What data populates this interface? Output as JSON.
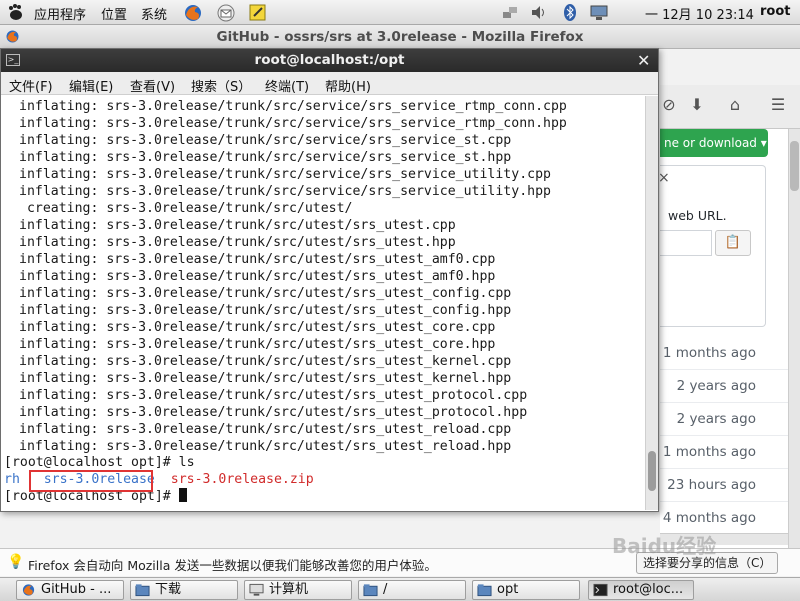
{
  "top_panel": {
    "applications": "应用程序",
    "places": "位置",
    "system": "系统",
    "clock": "一 12月 10 23:14",
    "user": "root"
  },
  "firefox": {
    "title": "GitHub - ossrs/srs at 3.0release - Mozilla Firefox",
    "clone_button": "ne or download ▾",
    "clone_popup_text": "web URL.",
    "commit_times": [
      "1 months ago",
      "2 years ago",
      "2 years ago",
      "1 months ago",
      "23 hours ago",
      "4 months ago"
    ],
    "notification": "Firefox 会自动向 Mozilla 发送一些数据以便我们能够改善您的用户体验。",
    "notification_button": "选择要分享的信息（C）"
  },
  "terminal": {
    "title": "root@localhost:/opt",
    "menu": [
      "文件(F)",
      "编辑(E)",
      "查看(V)",
      "搜索（S）",
      "终端(T)",
      "帮助(H)"
    ],
    "lines": [
      "inflating: srs-3.0release/trunk/src/service/srs_service_rtmp_conn.cpp",
      "inflating: srs-3.0release/trunk/src/service/srs_service_rtmp_conn.hpp",
      "inflating: srs-3.0release/trunk/src/service/srs_service_st.cpp",
      "inflating: srs-3.0release/trunk/src/service/srs_service_st.hpp",
      "inflating: srs-3.0release/trunk/src/service/srs_service_utility.cpp",
      "inflating: srs-3.0release/trunk/src/service/srs_service_utility.hpp",
      " creating: srs-3.0release/trunk/src/utest/",
      "inflating: srs-3.0release/trunk/src/utest/srs_utest.cpp",
      "inflating: srs-3.0release/trunk/src/utest/srs_utest.hpp",
      "inflating: srs-3.0release/trunk/src/utest/srs_utest_amf0.cpp",
      "inflating: srs-3.0release/trunk/src/utest/srs_utest_amf0.hpp",
      "inflating: srs-3.0release/trunk/src/utest/srs_utest_config.cpp",
      "inflating: srs-3.0release/trunk/src/utest/srs_utest_config.hpp",
      "inflating: srs-3.0release/trunk/src/utest/srs_utest_core.cpp",
      "inflating: srs-3.0release/trunk/src/utest/srs_utest_core.hpp",
      "inflating: srs-3.0release/trunk/src/utest/srs_utest_kernel.cpp",
      "inflating: srs-3.0release/trunk/src/utest/srs_utest_kernel.hpp",
      "inflating: srs-3.0release/trunk/src/utest/srs_utest_protocol.cpp",
      "inflating: srs-3.0release/trunk/src/utest/srs_utest_protocol.hpp",
      "inflating: srs-3.0release/trunk/src/utest/srs_utest_reload.cpp",
      "inflating: srs-3.0release/trunk/src/utest/srs_utest_reload.hpp"
    ],
    "prompt1": "[root@localhost opt]# ls",
    "ls_dir1": "rh",
    "ls_dir2": "srs-3.0release",
    "ls_zip": "srs-3.0release.zip",
    "prompt2": "[root@localhost opt]# "
  },
  "taskbar": [
    "GitHub - ...",
    "下载",
    "计算机",
    "/",
    "opt",
    "root@loc..."
  ],
  "watermark": "Baidu经验",
  "colors": {
    "dir": "#3a73c9",
    "zip": "#d12b2b",
    "highlight": "#e03434",
    "clone_green": "#2ea44f"
  }
}
